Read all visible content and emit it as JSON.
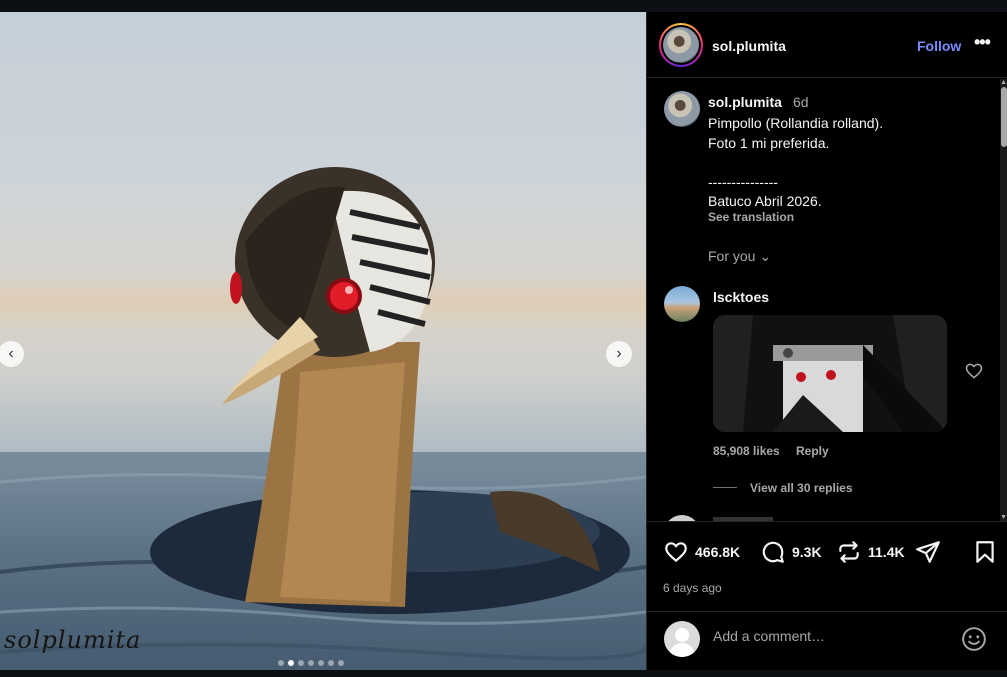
{
  "post": {
    "username": "sol.plumita",
    "follow_label": "Follow",
    "more_label": "•••",
    "media": {
      "watermark": "solplumita",
      "slide_count": 7,
      "active_slide": 2
    }
  },
  "caption": {
    "username": "sol.plumita",
    "time": "6d",
    "line1": "Pimpollo (Rollandia rolland).",
    "line2": "Foto 1 mi preferida.",
    "line3": "---------------",
    "line4": "Batuco Abril 2026.",
    "see_translation": "See translation",
    "for_you": "For you"
  },
  "comment": {
    "username": "lscktoes",
    "likes": "85,908 likes",
    "reply": "Reply",
    "view_replies": "View all 30 replies"
  },
  "actions": {
    "likes": "466.8K",
    "comments": "9.3K",
    "reposts": "11.4K",
    "time_ago": "6 days ago"
  },
  "add_comment": {
    "placeholder": "Add a comment…"
  },
  "colors": {
    "follow": "#7a8cff",
    "background": "#000000",
    "muted": "#a8a8a8"
  },
  "icons": {
    "prev": "chevron-left-icon",
    "next": "chevron-right-icon",
    "like": "heart-icon",
    "comment": "speech-bubble-icon",
    "repost": "repost-icon",
    "share": "paper-plane-icon",
    "save": "bookmark-icon",
    "emoji": "smiley-icon"
  }
}
